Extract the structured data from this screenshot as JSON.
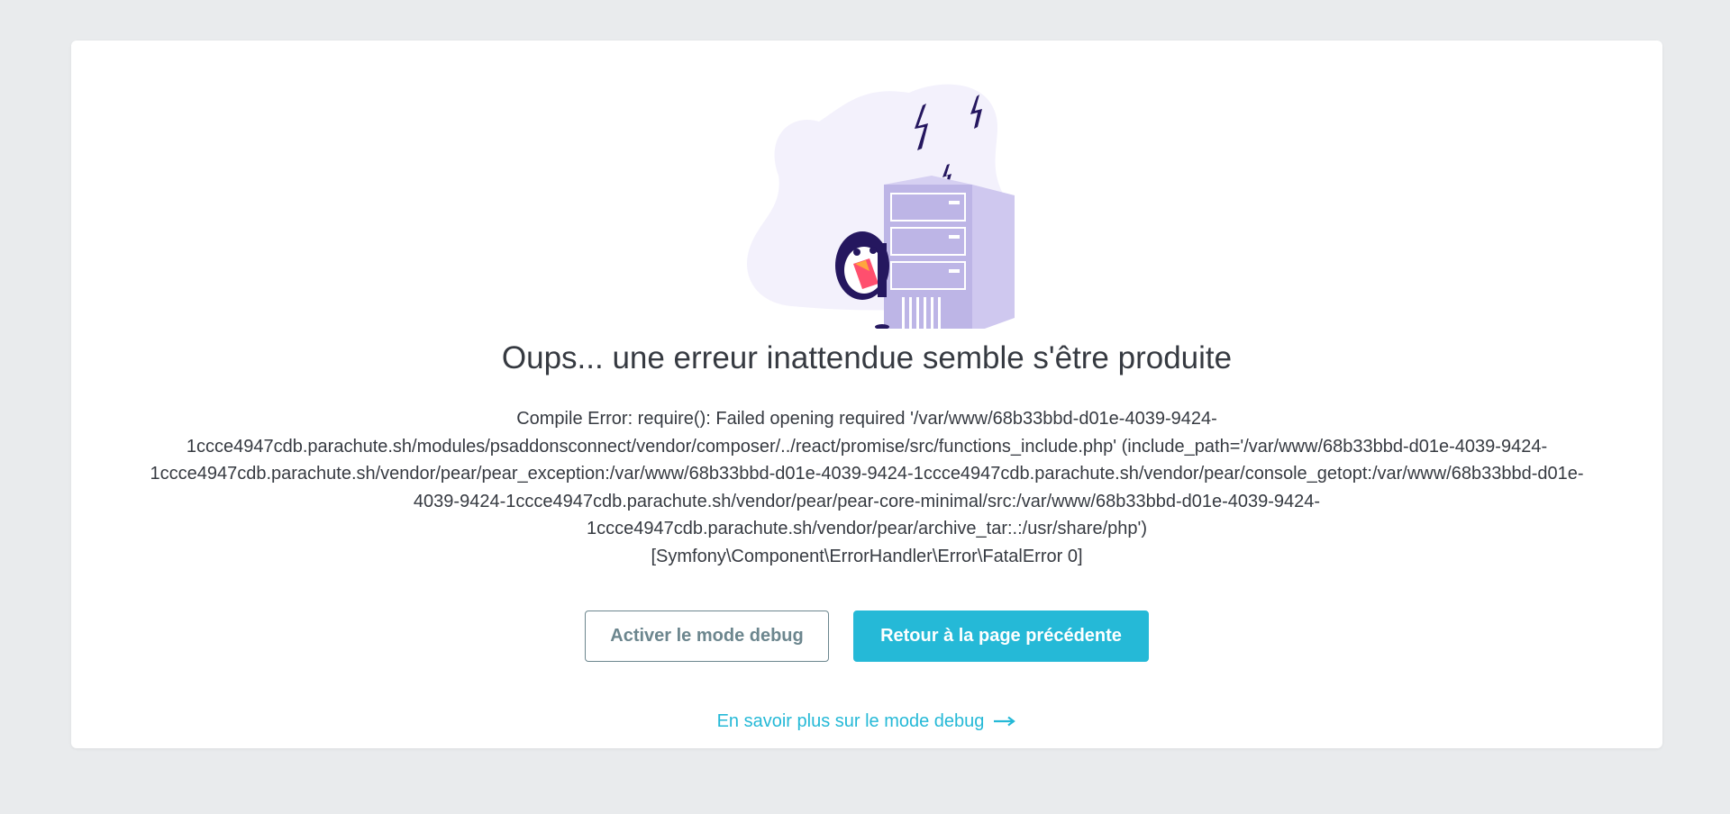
{
  "page": {
    "title": "Oups... une erreur inattendue semble s'être produite",
    "error_lines": [
      "Compile Error: require(): Failed opening required '/var/www/68b33bbd-d01e-4039-9424-",
      "1ccce4947cdb.parachute.sh/modules/psaddonsconnect/vendor/composer/../react/promise/src/functions_include.php' (include_path='/var/www/68b33bbd-d01e-4039-9424-",
      "1ccce4947cdb.parachute.sh/vendor/pear/pear_exception:/var/www/68b33bbd-d01e-4039-9424-1ccce4947cdb.parachute.sh/vendor/pear/console_getopt:/var/www/68b33bbd-d01e-",
      "4039-9424-1ccce4947cdb.parachute.sh/vendor/pear/pear-core-minimal/src:/var/www/68b33bbd-d01e-4039-9424-",
      "1ccce4947cdb.parachute.sh/vendor/pear/archive_tar:.:/usr/share/php')",
      "[Symfony\\Component\\ErrorHandler\\Error\\FatalError 0]"
    ]
  },
  "actions": {
    "debug_label": "Activer le mode debug",
    "back_label": "Retour à la page précédente",
    "learn_more_label": "En savoir plus sur le mode debug"
  },
  "icons": {
    "illustration": "server-error-puffin-illustration",
    "learn_more": "arrow-right-icon"
  },
  "colors": {
    "background": "#e9ebed",
    "text": "#363a41",
    "primary": "#25b9d7",
    "outline": "#6c868e",
    "illustration_blob": "#f3f1fc",
    "server": "#bdb5e6",
    "lightning": "#25175f"
  }
}
